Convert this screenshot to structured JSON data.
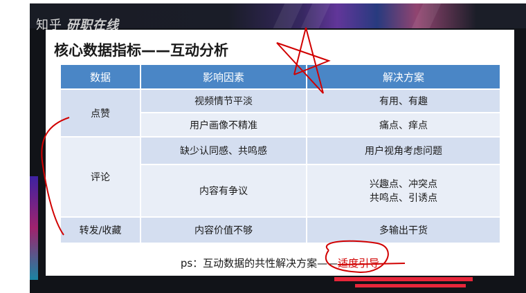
{
  "brand": {
    "name": "知乎",
    "sub": "研职在线"
  },
  "slide": {
    "title": "核心数据指标——互动分析",
    "headers": [
      "数据",
      "影响因素",
      "解决方案"
    ],
    "groups": [
      {
        "metric": "点赞",
        "rows": [
          {
            "factor": "视频情节平淡",
            "solution": "有用、有趣"
          },
          {
            "factor": "用户画像不精准",
            "solution": "痛点、痒点"
          }
        ]
      },
      {
        "metric": "评论",
        "rows": [
          {
            "factor": "缺少认同感、共鸣感",
            "solution": "用户视角考虑问题"
          },
          {
            "factor": "内容有争议",
            "solution": "兴趣点、冲突点",
            "solution2": "共鸣点、引诱点"
          }
        ]
      },
      {
        "metric": "转发/收藏",
        "rows": [
          {
            "factor": "内容价值不够",
            "solution": "多输出干货"
          }
        ]
      }
    ],
    "ps_text": "ps：互动数据的共性解决方案——",
    "ps_highlight": "适度引导"
  },
  "colors": {
    "header_blue": "#4a86c6",
    "row_light": "#d4def0",
    "row_pale": "#e9eef7",
    "annotation_red": "#d10000"
  }
}
